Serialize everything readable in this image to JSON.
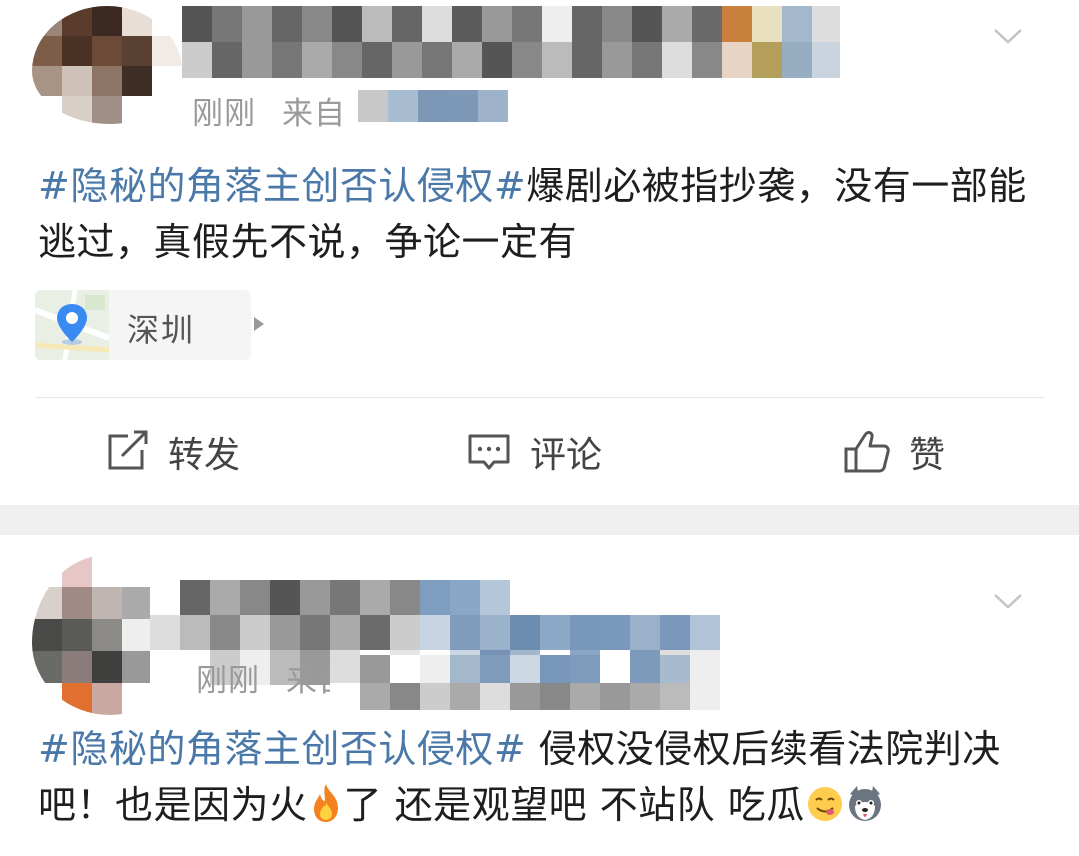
{
  "posts": [
    {
      "time": "刚刚",
      "source_prefix": "来自",
      "hashtag": "#隐秘的角落主创否认侵权#",
      "body": "爆剧必被指抄袭，没有一部能逃过，真假先不说，争论一定有",
      "location": "深圳",
      "actions": {
        "repost": "转发",
        "comment": "评论",
        "like": "赞"
      }
    },
    {
      "time": "刚刚",
      "source_prefix": "来自",
      "hashtag": "#隐秘的角落主创否认侵权#",
      "body_part1": " 侵权没侵权后续看法院判决吧！也是因为火",
      "body_part2": "了 还是观望吧 不站队 吃瓜"
    }
  ],
  "icons": {
    "expand": "chevron-down-icon",
    "location": "location-pin-icon",
    "repost": "repost-icon",
    "comment": "comment-icon",
    "like": "thumbs-up-icon",
    "fire": "fire-emoji",
    "yum": "yum-face-emoji",
    "husky": "husky-emoji"
  },
  "colors": {
    "hashtag": "#4a78a8",
    "meta": "#9a9a9a",
    "divider": "#efefef"
  }
}
